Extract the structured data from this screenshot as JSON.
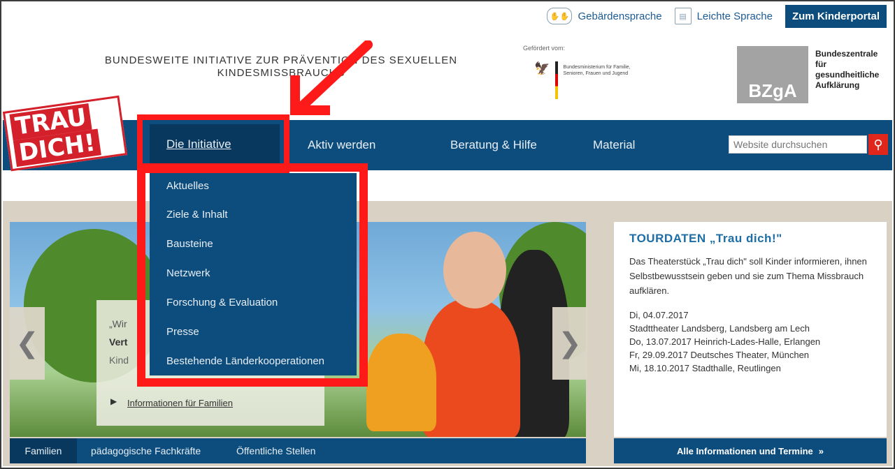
{
  "util": {
    "gebaerden": "Gebärdensprache",
    "leicht": "Leichte Sprache",
    "kinder": "Zum Kinderportal"
  },
  "header": {
    "tagline_line1": "BUNDESWEITE INITIATIVE ZUR PRÄVENTION DES SEXUELLEN",
    "tagline_line2": "KINDESMISSBRAUCHS",
    "gefoerdert": "Gefördert vom:",
    "ministry": "Bundesministerium für Familie, Senioren, Frauen und Jugend",
    "bzga_logo": "BZgA",
    "bzga_text": [
      "Bundeszentrale",
      "für",
      "gesundheitliche",
      "Aufklärung"
    ]
  },
  "logo": {
    "line1": "TRAU",
    "line2": "DICH!"
  },
  "nav": {
    "items": [
      "Die Initiative",
      "Aktiv werden",
      "Beratung & Hilfe",
      "Material"
    ],
    "search_placeholder": "Website durchsuchen"
  },
  "dropdown": {
    "items": [
      "Aktuelles",
      "Ziele & Inhalt",
      "Bausteine",
      "Netzwerk",
      "Forschung & Evaluation",
      "Presse",
      "Bestehende Länderkooperationen"
    ]
  },
  "teaser": {
    "line1": "„Wir",
    "line2": "Vert",
    "line3": "Kind",
    "link": "Informationen für Familien"
  },
  "tabs": [
    "Familien",
    "pädagogische Fachkräfte",
    "Öffentliche Stellen"
  ],
  "sidebar": {
    "title": "TOURDATEN „Trau dich!\"",
    "intro": "Das Theaterstück „Trau dich\" soll Kinder informieren, ihnen Selbstbewusstsein geben und sie zum Thema Missbrauch aufklären.",
    "dates": [
      "Di, 04.07.2017",
      "Stadttheater Landsberg, Landsberg am Lech",
      "Do, 13.07.2017   Heinrich-Lades-Halle, Erlangen",
      "Fr, 29.09.2017   Deutsches Theater, München",
      "Mi, 18.10.2017   Stadthalle, Reutlingen"
    ],
    "button": "Alle Informationen und Termine"
  },
  "colors": {
    "nav_blue": "#0c4d7d",
    "highlight_red": "#ff1a1a",
    "brand_red": "#d4202b"
  }
}
